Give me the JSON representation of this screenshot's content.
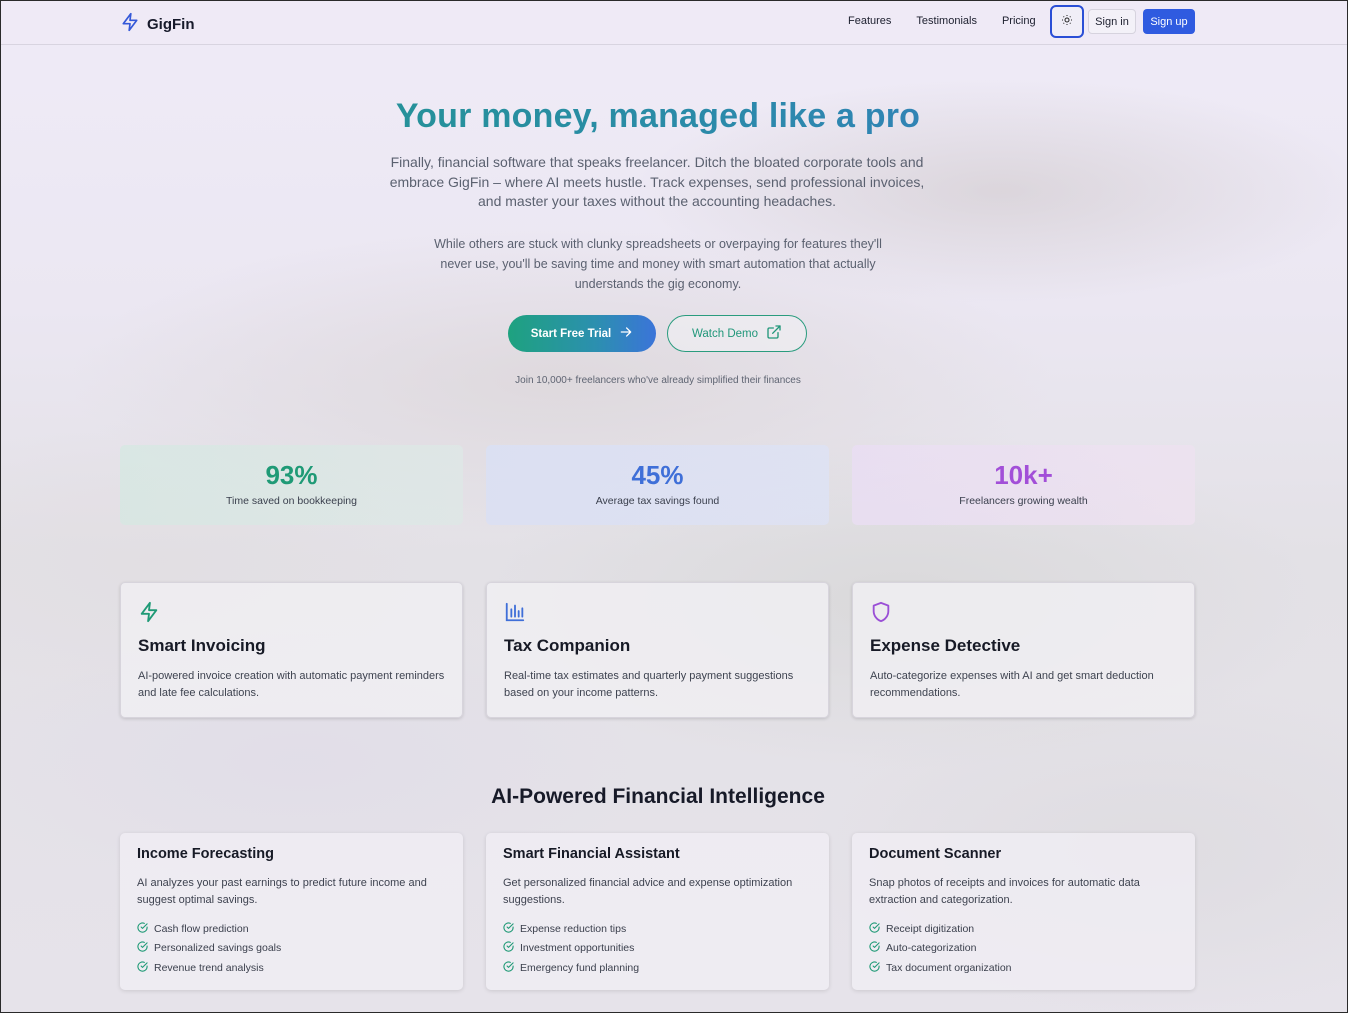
{
  "header": {
    "logo_text": "GigFin",
    "nav": [
      "Features",
      "Testimonials",
      "Pricing"
    ],
    "signin_label": "Sign in",
    "signup_label": "Sign up"
  },
  "hero": {
    "title": "Your money, managed like a pro",
    "paragraph1": "Finally, financial software that speaks freelancer. Ditch the bloated corporate tools and embrace GigFin – where AI meets hustle. Track expenses, send professional invoices, and master your taxes without the accounting headaches.",
    "paragraph2": "While others are stuck with clunky spreadsheets or overpaying for features they'll never use, you'll be saving time and money with smart automation that actually understands the gig economy.",
    "cta_primary": "Start Free Trial",
    "cta_secondary": "Watch Demo",
    "join_text": "Join 10,000+ freelancers who've already simplified their finances"
  },
  "stats": [
    {
      "value": "93%",
      "label": "Time saved on bookkeeping",
      "color": "#1f9a76"
    },
    {
      "value": "45%",
      "label": "Average tax savings found",
      "color": "#3f6fd8"
    },
    {
      "value": "10k+",
      "label": "Freelancers growing wealth",
      "color": "#a24fd8"
    }
  ],
  "features": [
    {
      "icon": "lightning-icon",
      "title": "Smart Invoicing",
      "description": "AI-powered invoice creation with automatic payment reminders and late fee calculations.",
      "color": "#1f9a76"
    },
    {
      "icon": "bar-chart-icon",
      "title": "Tax Companion",
      "description": "Real-time tax estimates and quarterly payment suggestions based on your income patterns.",
      "color": "#3f6fd8"
    },
    {
      "icon": "shield-icon",
      "title": "Expense Detective",
      "description": "Auto-categorize expenses with AI and get smart deduction recommendations.",
      "color": "#9a4fd6"
    }
  ],
  "ai_section": {
    "title": "AI-Powered Financial Intelligence",
    "cards": [
      {
        "title": "Income Forecasting",
        "description": "AI analyzes your past earnings to predict future income and suggest optimal savings.",
        "items": [
          "Cash flow prediction",
          "Personalized savings goals",
          "Revenue trend analysis"
        ]
      },
      {
        "title": "Smart Financial Assistant",
        "description": "Get personalized financial advice and expense optimization suggestions.",
        "items": [
          "Expense reduction tips",
          "Investment opportunities",
          "Emergency fund planning"
        ]
      },
      {
        "title": "Document Scanner",
        "description": "Snap photos of receipts and invoices for automatic data extraction and categorization.",
        "items": [
          "Receipt digitization",
          "Auto-categorization",
          "Tax document organization"
        ]
      }
    ]
  },
  "colors": {
    "brand_blue": "#2f5be0",
    "check_green": "#1f9a76"
  }
}
